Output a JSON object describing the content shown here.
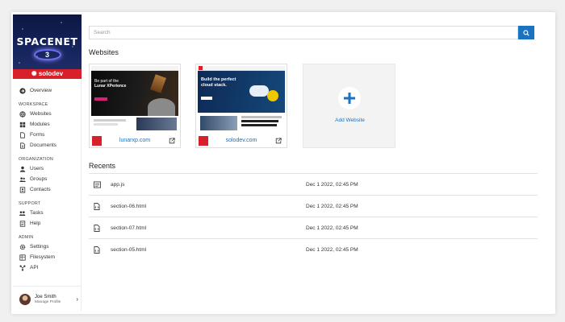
{
  "sidebar": {
    "brand": {
      "title": "SPACENET",
      "emblem": "3",
      "company": "solodev"
    },
    "overview_label": "Overview",
    "sections": [
      {
        "title": "WORKSPACE",
        "items": [
          {
            "label": "Websites",
            "icon": "globe-icon"
          },
          {
            "label": "Modules",
            "icon": "grid-icon"
          },
          {
            "label": "Forms",
            "icon": "file-icon"
          },
          {
            "label": "Documents",
            "icon": "document-icon"
          }
        ]
      },
      {
        "title": "ORGANIZATION",
        "items": [
          {
            "label": "Users",
            "icon": "user-icon"
          },
          {
            "label": "Groups",
            "icon": "users-icon"
          },
          {
            "label": "Contacts",
            "icon": "contact-icon"
          }
        ]
      },
      {
        "title": "SUPPORT",
        "items": [
          {
            "label": "Tasks",
            "icon": "tasks-icon"
          },
          {
            "label": "Help",
            "icon": "help-icon"
          }
        ]
      },
      {
        "title": "ADMIN",
        "items": [
          {
            "label": "Settings",
            "icon": "gear-icon"
          },
          {
            "label": "Filesystem",
            "icon": "filesystem-icon"
          },
          {
            "label": "API",
            "icon": "api-icon"
          }
        ]
      }
    ],
    "profile": {
      "name": "Joe Smith",
      "subtitle": "Manage Profile"
    }
  },
  "search": {
    "placeholder": "Search"
  },
  "websites": {
    "title": "Websites",
    "cards": [
      {
        "url": "lunarxp.com",
        "hero_line1": "Be part of the",
        "hero_line2": "Lunar XPerience"
      },
      {
        "url": "solodev.com",
        "hero_line1": "Build the perfect",
        "hero_line2": "cloud stack."
      }
    ],
    "add_label": "Add Website"
  },
  "recents": {
    "title": "Recents",
    "rows": [
      {
        "name": "app.js",
        "date": "Dec 1 2022, 02:45 PM",
        "icon": "code-file-icon"
      },
      {
        "name": "section-06.html",
        "date": "Dec 1 2022, 02:45 PM",
        "icon": "html-file-icon"
      },
      {
        "name": "section-07.html",
        "date": "Dec 1 2022, 02:45 PM",
        "icon": "html-file-icon"
      },
      {
        "name": "section-05.html",
        "date": "Dec 1 2022, 02:45 PM",
        "icon": "html-file-icon"
      }
    ]
  },
  "colors": {
    "accent": "#1a72c0",
    "brand_red": "#d8202a",
    "banner_navy": "#16245e"
  }
}
